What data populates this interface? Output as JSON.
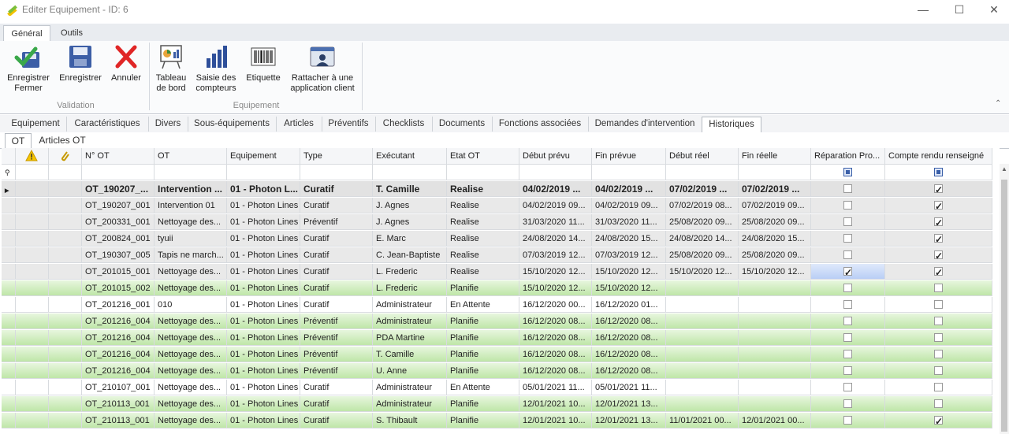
{
  "window": {
    "title": "Editer Equipement - ID: 6",
    "minimize": "—",
    "maximize": "☐",
    "close": "✕"
  },
  "ribbon_tabs": [
    "Général",
    "Outils"
  ],
  "ribbon": {
    "save_close": "Enregistrer Fermer",
    "save": "Enregistrer",
    "cancel": "Annuler",
    "dashboard": "Tableau de bord",
    "counters": "Saisie des compteurs",
    "label": "Etiquette",
    "attach": "Rattacher à une application client",
    "group_validation": "Validation",
    "group_equipement": "Equipement"
  },
  "tabs": [
    "Equipement",
    "Caractéristiques",
    "Divers",
    "Sous-équipements",
    "Articles",
    "Préventifs",
    "Checklists",
    "Documents",
    "Fonctions associées",
    "Demandes d'intervention",
    "Historiques"
  ],
  "subtabs": [
    "OT",
    "Articles OT"
  ],
  "columns": [
    "N° OT",
    "OT",
    "Equipement",
    "Type",
    "Exécutant",
    "Etat OT",
    "Début prévu",
    "Fin prévue",
    "Début réel",
    "Fin réelle",
    "Réparation Pro...",
    "Compte rendu renseigné"
  ],
  "rows": [
    {
      "style": "grp",
      "cells": [
        "OT_190207_...",
        "Intervention ...",
        "01 - Photon L...",
        "Curatif",
        "T. Camille",
        "Realise",
        "04/02/2019 ...",
        "04/02/2019 ...",
        "07/02/2019 ...",
        "07/02/2019 ..."
      ],
      "rep": false,
      "cr": true
    },
    {
      "style": "grey",
      "cells": [
        "OT_190207_001",
        "Intervention 01",
        "01 - Photon Lines",
        "Curatif",
        "J. Agnes",
        "Realise",
        "04/02/2019 09...",
        "04/02/2019 09...",
        "07/02/2019 08...",
        "07/02/2019 09..."
      ],
      "rep": false,
      "cr": true
    },
    {
      "style": "grey",
      "cells": [
        "OT_200331_001",
        "Nettoyage des...",
        "01 - Photon Lines",
        "Préventif",
        "J. Agnes",
        "Realise",
        "31/03/2020 11...",
        "31/03/2020 11...",
        "25/08/2020 09...",
        "25/08/2020 09..."
      ],
      "rep": false,
      "cr": true
    },
    {
      "style": "grey",
      "cells": [
        "OT_200824_001",
        "tyuii",
        "01 - Photon Lines",
        "Curatif",
        "E. Marc",
        "Realise",
        "24/08/2020 14...",
        "24/08/2020 15...",
        "24/08/2020 14...",
        "24/08/2020 15..."
      ],
      "rep": false,
      "cr": true
    },
    {
      "style": "grey",
      "cells": [
        "OT_190307_005",
        "Tapis ne march...",
        "01 - Photon Lines",
        "Curatif",
        "C. Jean-Baptiste",
        "Realise",
        "07/03/2019 12...",
        "07/03/2019 12...",
        "25/08/2020 09...",
        "25/08/2020 09..."
      ],
      "rep": false,
      "cr": true
    },
    {
      "style": "grey",
      "cells": [
        "OT_201015_001",
        "Nettoyage des...",
        "01 - Photon Lines",
        "Curatif",
        "L. Frederic",
        "Realise",
        "15/10/2020 12...",
        "15/10/2020 12...",
        "15/10/2020 12...",
        "15/10/2020 12..."
      ],
      "rep": true,
      "cr": true,
      "selected": true
    },
    {
      "style": "green",
      "cells": [
        "OT_201015_002",
        "Nettoyage des...",
        "01 - Photon Lines",
        "Curatif",
        "L. Frederic",
        "Planifie",
        "15/10/2020 12...",
        "15/10/2020 12...",
        "",
        ""
      ],
      "rep": false,
      "cr": false
    },
    {
      "style": "white",
      "cells": [
        "OT_201216_001",
        "010",
        "01 - Photon Lines",
        "Curatif",
        "Administrateur",
        "En Attente",
        "16/12/2020 00...",
        "16/12/2020 01...",
        "",
        ""
      ],
      "rep": false,
      "cr": false
    },
    {
      "style": "green",
      "cells": [
        "OT_201216_004",
        "Nettoyage des...",
        "01 - Photon Lines",
        "Préventif",
        "Administrateur",
        "Planifie",
        "16/12/2020 08...",
        "16/12/2020 08...",
        "",
        ""
      ],
      "rep": false,
      "cr": false
    },
    {
      "style": "green",
      "cells": [
        "OT_201216_004",
        "Nettoyage des...",
        "01 - Photon Lines",
        "Préventif",
        "PDA Martine",
        "Planifie",
        "16/12/2020 08...",
        "16/12/2020 08...",
        "",
        ""
      ],
      "rep": false,
      "cr": false
    },
    {
      "style": "green",
      "cells": [
        "OT_201216_004",
        "Nettoyage des...",
        "01 - Photon Lines",
        "Préventif",
        "T. Camille",
        "Planifie",
        "16/12/2020 08...",
        "16/12/2020 08...",
        "",
        ""
      ],
      "rep": false,
      "cr": false
    },
    {
      "style": "green",
      "cells": [
        "OT_201216_004",
        "Nettoyage des...",
        "01 - Photon Lines",
        "Préventif",
        "U. Anne",
        "Planifie",
        "16/12/2020 08...",
        "16/12/2020 08...",
        "",
        ""
      ],
      "rep": false,
      "cr": false
    },
    {
      "style": "white",
      "cells": [
        "OT_210107_001",
        "Nettoyage des...",
        "01 - Photon Lines",
        "Curatif",
        "Administrateur",
        "En Attente",
        "05/01/2021 11...",
        "05/01/2021 11...",
        "",
        ""
      ],
      "rep": false,
      "cr": false
    },
    {
      "style": "green",
      "cells": [
        "OT_210113_001",
        "Nettoyage des...",
        "01 - Photon Lines",
        "Curatif",
        "Administrateur",
        "Planifie",
        "12/01/2021 10...",
        "12/01/2021 13...",
        "",
        ""
      ],
      "rep": false,
      "cr": false
    },
    {
      "style": "green",
      "cells": [
        "OT_210113_001",
        "Nettoyage des...",
        "01 - Photon Lines",
        "Curatif",
        "S. Thibault",
        "Planifie",
        "12/01/2021 10...",
        "12/01/2021 13...",
        "11/01/2021 00...",
        "12/01/2021 00..."
      ],
      "rep": false,
      "cr": true
    }
  ]
}
